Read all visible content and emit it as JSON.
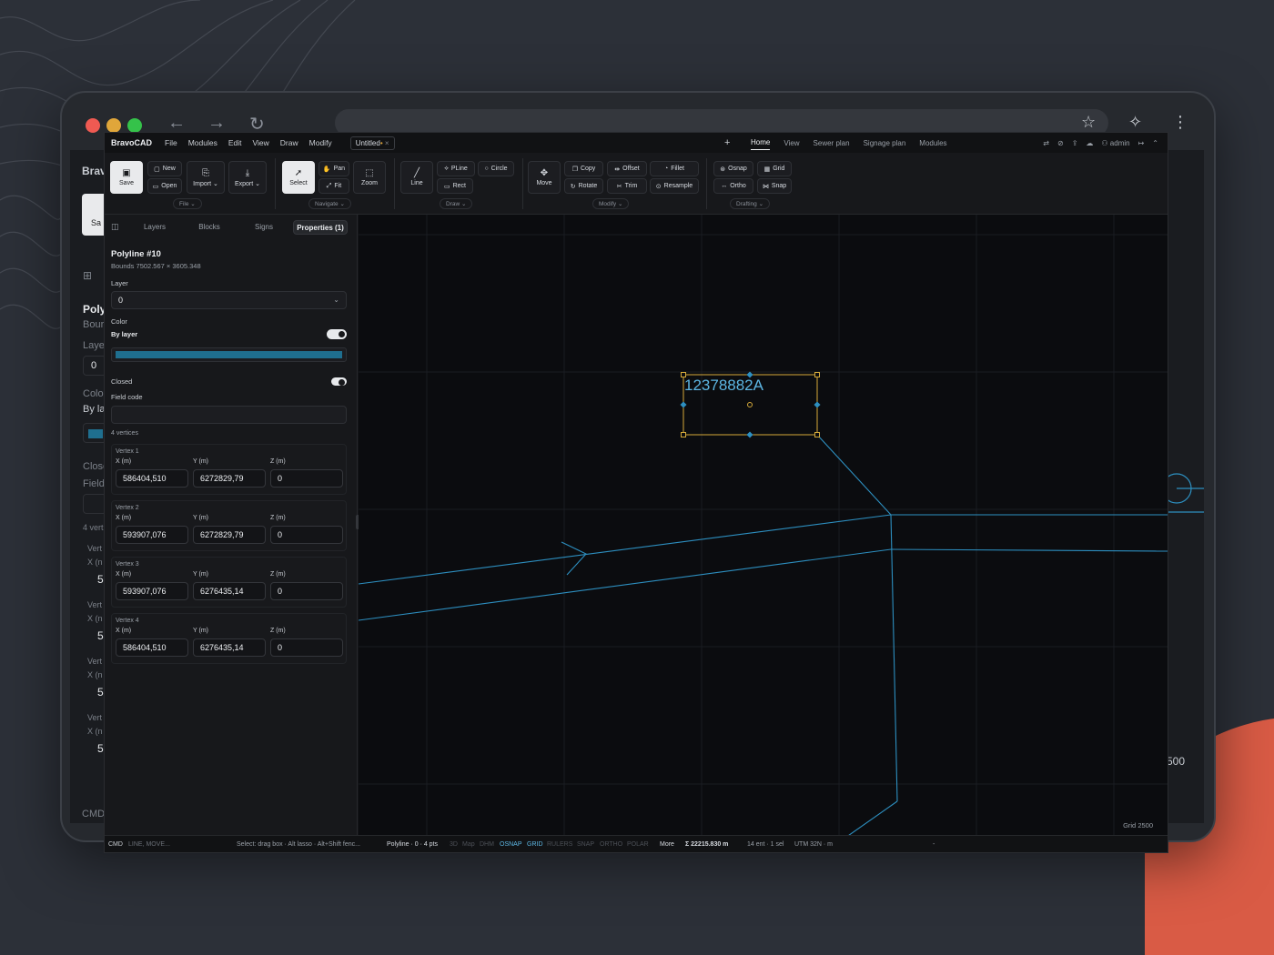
{
  "app": {
    "brand": "BravoCAD",
    "menu": [
      "File",
      "Modules",
      "Edit",
      "View",
      "Draw",
      "Modify"
    ],
    "doc_tab": "Untitled",
    "doc_tab_modified": "•",
    "doc_tab_close": "×",
    "new_tab": "+",
    "right_tabs": [
      "Home",
      "View",
      "Sewer plan",
      "Signage plan",
      "Modules"
    ],
    "user": "admin"
  },
  "ribbon": {
    "file": {
      "save": "Save",
      "new": "New",
      "open": "Open",
      "import": "Import",
      "export": "Export",
      "group": "File"
    },
    "navigate": {
      "select": "Select",
      "pan": "Pan",
      "fit": "Fit",
      "zoom": "Zoom",
      "group": "Navigate"
    },
    "draw": {
      "line": "Line",
      "pline": "PLine",
      "circle": "Circle",
      "rect": "Rect",
      "group": "Draw"
    },
    "modify": {
      "move": "Move",
      "copy": "Copy",
      "offset": "Offset",
      "fillet": "Fillet",
      "rotate": "Rotate",
      "trim": "Trim",
      "resample": "Resample",
      "group": "Modify"
    },
    "drafting": {
      "osnap": "Osnap",
      "grid": "Grid",
      "ortho": "Ortho",
      "snap": "Snap",
      "group": "Drafting"
    }
  },
  "panel": {
    "tabs": [
      "Layers",
      "Blocks",
      "Signs",
      "Properties (1)"
    ],
    "title": "Polyline #10",
    "bounds": "Bounds 7502.567 × 3605.348",
    "layer_label": "Layer",
    "layer_value": "0",
    "color_label": "Color",
    "by_layer_label": "By layer",
    "by_layer_on": true,
    "color_hex": "#1f6f8f",
    "closed_label": "Closed",
    "closed_on": true,
    "field_code_label": "Field code",
    "field_code_value": "",
    "vertex_count": "4 vertices",
    "axes": [
      "X (m)",
      "Y (m)",
      "Z (m)"
    ],
    "vertices": [
      {
        "name": "Vertex 1",
        "x": "586404,510",
        "y": "6272829,79",
        "z": "0"
      },
      {
        "name": "Vertex 2",
        "x": "593907,076",
        "y": "6272829,79",
        "z": "0"
      },
      {
        "name": "Vertex 3",
        "x": "593907,076",
        "y": "6276435,14",
        "z": "0"
      },
      {
        "name": "Vertex 4",
        "x": "586404,510",
        "y": "6276435,14",
        "z": "0"
      }
    ]
  },
  "canvas": {
    "label_text": "12378882A",
    "grid_label": "Grid 2500"
  },
  "status": {
    "cmd": "CMD",
    "cmd_placeholder": "LINE, MOVE...",
    "hint": "Select: drag box · Alt lasso · Alt+Shift fenc...",
    "selection": "Polyline · 0 · 4 pts",
    "toggles_off": [
      "3D",
      "Map",
      "DHM"
    ],
    "toggles_on": [
      "OSNAP",
      "GRID"
    ],
    "toggles_off2": [
      "RULERS",
      "SNAP",
      "ORTHO",
      "POLAR"
    ],
    "more": "More",
    "length": "Σ 22215.830 m",
    "entities": "14 ent · 1 sel",
    "crs": "UTM 32N · m",
    "dash": "-"
  },
  "ghost": {
    "brand": "Brav",
    "save": "Sa",
    "poly": "Poly",
    "bounds": "Bour",
    "layer": "Laye",
    "layer_val": "0",
    "color": "Colo",
    "bylayer": "By la",
    "closed": "Close",
    "field": "Field",
    "verts": "4 vert",
    "vert": "Vert",
    "x": "X (n",
    "val": "5",
    "cmd": "CMD",
    "num": "500"
  },
  "colors": {
    "accent": "#5db6e3",
    "selection": "#d4a93a",
    "geometry": "#2d8fc0"
  }
}
